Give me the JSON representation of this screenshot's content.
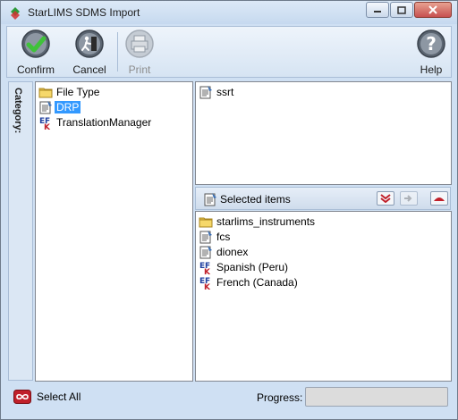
{
  "window": {
    "title": "StarLIMS SDMS Import"
  },
  "toolbar": {
    "confirm_label": "Confirm",
    "cancel_label": "Cancel",
    "print_label": "Print",
    "help_label": "Help"
  },
  "category": {
    "label": "Category:"
  },
  "tree": {
    "items": [
      {
        "label": "File Type",
        "icon": "folder-icon",
        "selected": false
      },
      {
        "label": "DRP",
        "icon": "document-icon",
        "selected": true
      },
      {
        "label": "TranslationManager",
        "icon": "translation-icon",
        "selected": false
      }
    ]
  },
  "available": {
    "items": [
      {
        "label": "ssrt",
        "icon": "document-icon"
      }
    ]
  },
  "selected": {
    "header": "Selected items",
    "items": [
      {
        "label": "starlims_instruments",
        "icon": "folder-icon"
      },
      {
        "label": "fcs",
        "icon": "document-icon"
      },
      {
        "label": "dionex",
        "icon": "document-icon"
      },
      {
        "label": "Spanish (Peru)",
        "icon": "translation-icon"
      },
      {
        "label": "French (Canada)",
        "icon": "translation-icon"
      }
    ]
  },
  "status": {
    "select_all_label": "Select All",
    "progress_label": "Progress:",
    "progress_value": 0
  },
  "colors": {
    "selection": "#3399ff",
    "accent_red": "#c0202a"
  }
}
